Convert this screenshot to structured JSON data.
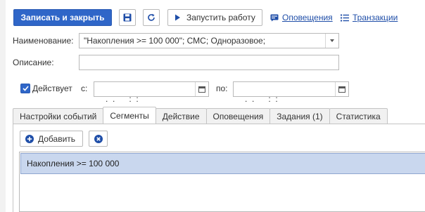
{
  "toolbar": {
    "save_close_label": "Записать и закрыть",
    "save_icon": "floppy-disk-icon",
    "refresh_icon": "refresh-icon",
    "run_label": "Запустить работу",
    "run_icon": "play-icon",
    "notifications_link": "Оповещения",
    "transactions_link": "Транзакции"
  },
  "form": {
    "name_label": "Наименование:",
    "name_value": "\"Накопления >= 100 000\"; СМС; Одноразовое;",
    "description_label": "Описание:",
    "description_value": "",
    "active_label": "Действует",
    "active_checked": true,
    "from_label": "с:",
    "from_value": " .  .      :  :",
    "to_label": "по:",
    "to_value": " .  .      :  :"
  },
  "tabs": [
    {
      "label": "Настройки событий",
      "active": false
    },
    {
      "label": "Сегменты",
      "active": true
    },
    {
      "label": "Действие",
      "active": false
    },
    {
      "label": "Оповещения",
      "active": false
    },
    {
      "label": "Задания (1)",
      "active": false
    },
    {
      "label": "Статистика",
      "active": false
    }
  ],
  "segments": {
    "add_label": "Добавить",
    "rows": [
      {
        "name": "Накопления >= 100 000"
      }
    ]
  },
  "colors": {
    "accent": "#2f66c8",
    "link": "#1f4ea8",
    "selected_row": "#c9d7ee"
  }
}
